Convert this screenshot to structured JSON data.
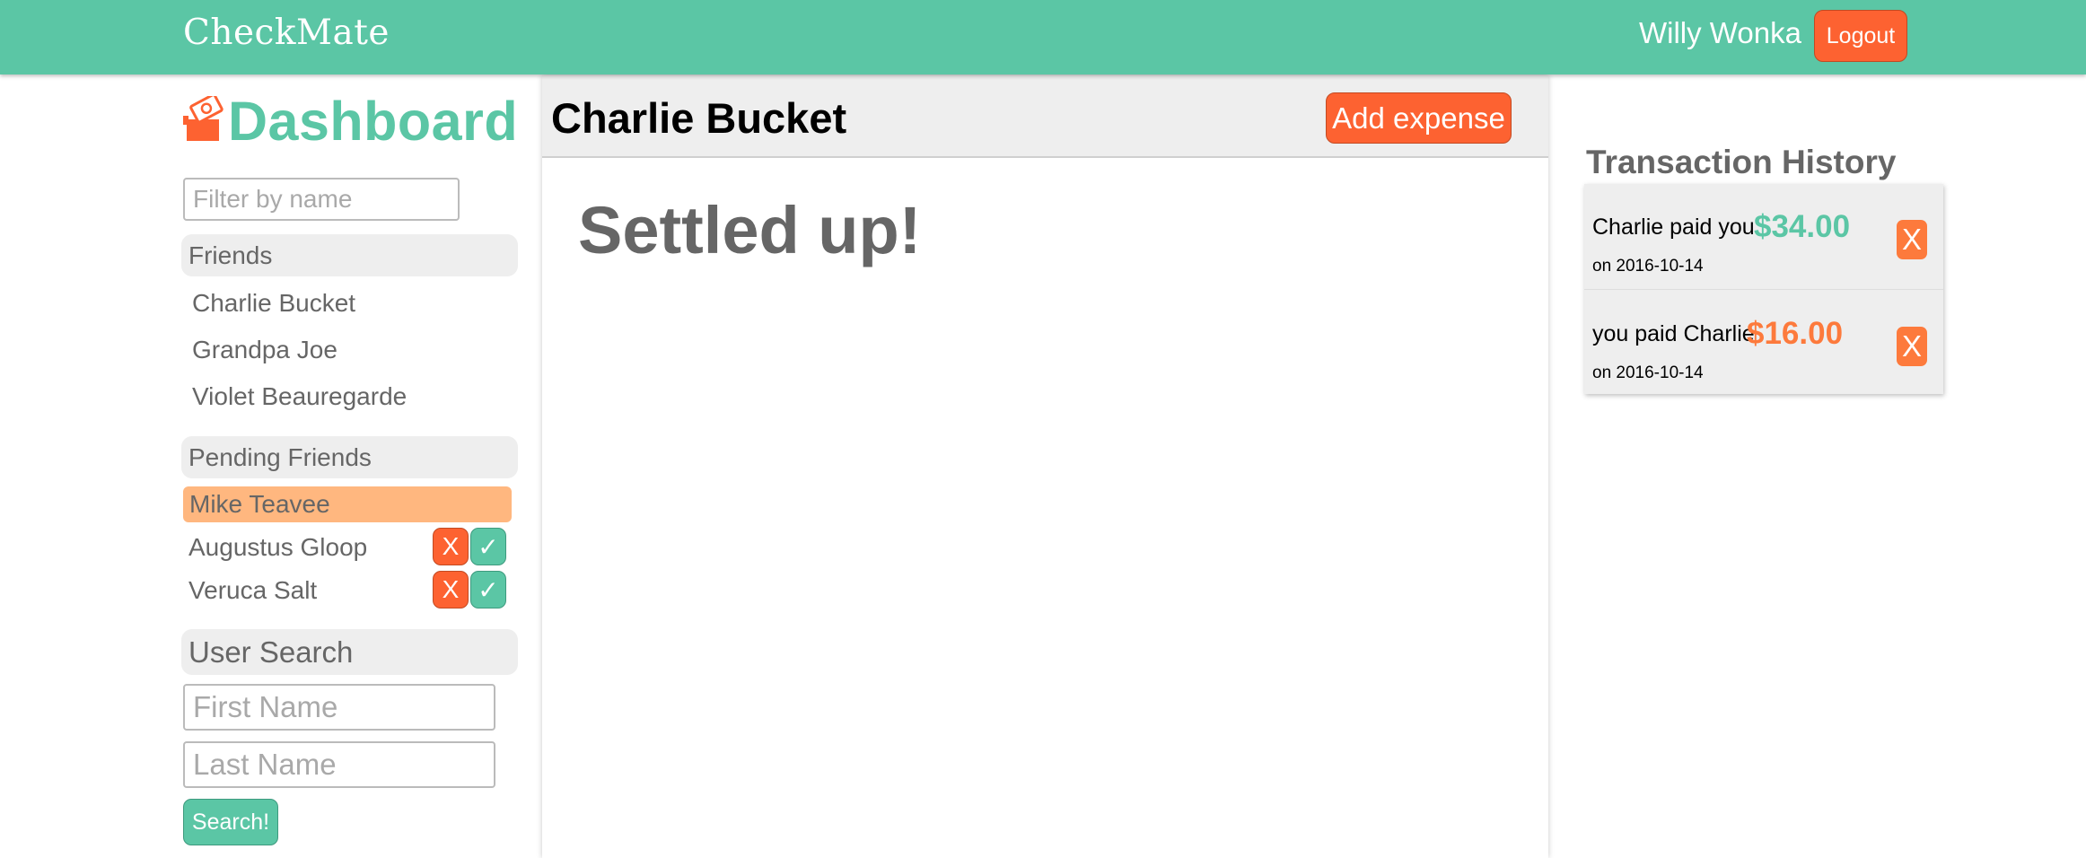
{
  "navbar": {
    "brand": "CheckMate",
    "username": "Willy Wonka",
    "logout_label": "Logout"
  },
  "sidebar": {
    "title": "Dashboard",
    "filter_placeholder": "Filter by name",
    "friends_header": "Friends",
    "friends": [
      "Charlie Bucket",
      "Grandpa Joe",
      "Violet Beauregarde"
    ],
    "pending_header": "Pending Friends",
    "pending_selected": "Mike Teavee",
    "pending_requests": [
      "Augustus Gloop",
      "Veruca Salt"
    ],
    "reject_label": "X",
    "accept_label": "✓",
    "user_search_header": "User Search",
    "first_name_placeholder": "First Name",
    "last_name_placeholder": "Last Name",
    "search_label": "Search!"
  },
  "main": {
    "friend_name": "Charlie Bucket",
    "add_expense_label": "Add expense",
    "status_text": "Settled up!"
  },
  "transactions": {
    "title": "Transaction History",
    "delete_label": "X",
    "items": [
      {
        "text": "Charlie paid you",
        "amount": "$34.00",
        "date": "on 2016-10-14",
        "amount_color": "#5bc6a5"
      },
      {
        "text": "you paid Charlie",
        "amount": "$16.00",
        "date": "on 2016-10-14",
        "amount_color": "#fd7a3c"
      }
    ]
  },
  "colors": {
    "brand_green": "#5bc6a5",
    "accent_orange": "#fd6231",
    "pending_highlight": "#ffb77f",
    "panel_gray": "#eeeeee"
  },
  "icons": {
    "dashboard": "money-box-icon"
  }
}
